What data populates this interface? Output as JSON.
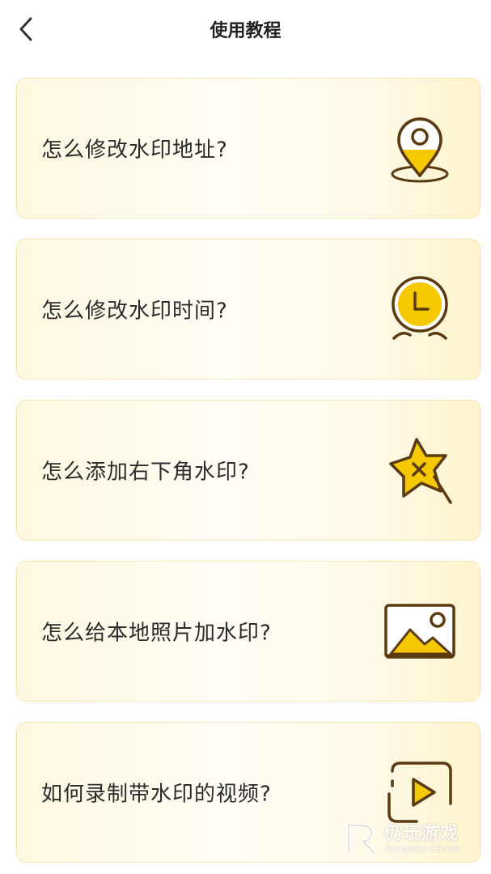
{
  "header": {
    "title": "使用教程",
    "back_icon": "chevron-left-icon"
  },
  "tutorials": [
    {
      "label": "怎么修改水印地址?",
      "icon": "location-pin-icon"
    },
    {
      "label": "怎么修改水印时间?",
      "icon": "alarm-clock-icon"
    },
    {
      "label": "怎么添加右下角水印?",
      "icon": "star-sticker-icon"
    },
    {
      "label": "怎么给本地照片加水印?",
      "icon": "image-icon"
    },
    {
      "label": "如何录制带水印的视频?",
      "icon": "video-play-icon"
    }
  ],
  "watermark": {
    "name": "仍玩游戏",
    "sub": "Rengwan Games"
  },
  "colors": {
    "accent": "#f6c800",
    "icon_stroke": "#5a3a10",
    "card_border": "#f1e6b4"
  }
}
